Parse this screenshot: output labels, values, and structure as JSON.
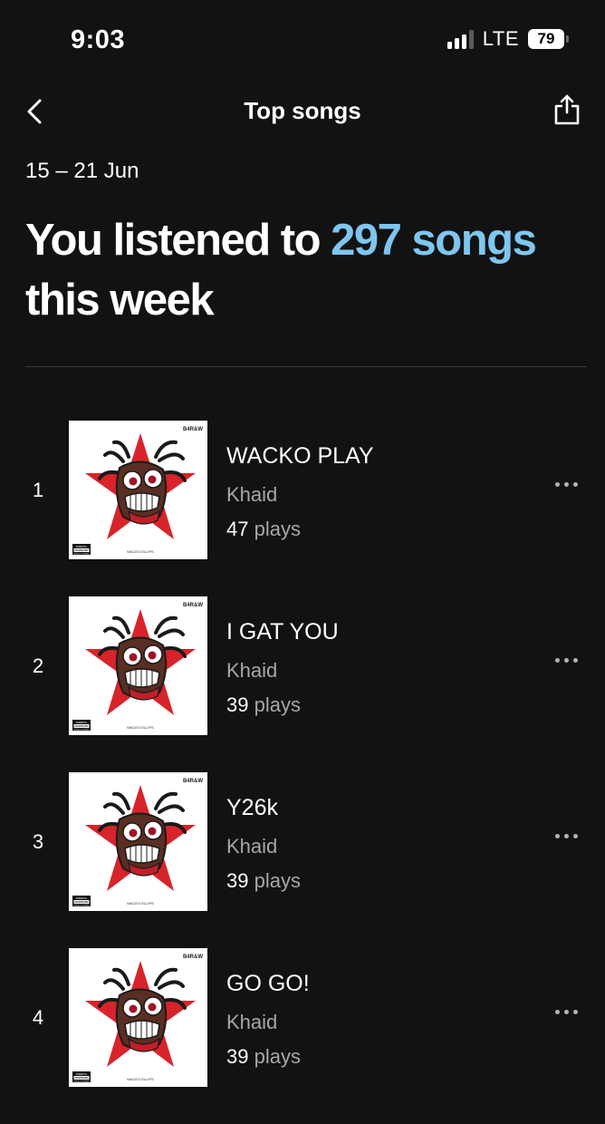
{
  "status_bar": {
    "time": "9:03",
    "network": "LTE",
    "battery": "79"
  },
  "nav": {
    "title": "Top songs",
    "back_icon": "chevron-left-icon",
    "share_icon": "share-icon"
  },
  "summary": {
    "date_range": "15 – 21 Jun",
    "headline_prefix": "You listened to ",
    "headline_count": "297 songs",
    "headline_suffix": "this week",
    "accent_color": "#7ec6ef"
  },
  "songs": [
    {
      "rank": "1",
      "title": "WACKO PLAY",
      "artist": "Khaid",
      "plays_count": "47",
      "plays_label": " plays"
    },
    {
      "rank": "2",
      "title": "I GAT YOU",
      "artist": "Khaid",
      "plays_count": "39",
      "plays_label": " plays"
    },
    {
      "rank": "3",
      "title": "Y26k",
      "artist": "Khaid",
      "plays_count": "39",
      "plays_label": " plays"
    },
    {
      "rank": "4",
      "title": "GO GO!",
      "artist": "Khaid",
      "plays_count": "39",
      "plays_label": " plays"
    }
  ],
  "cover_art": {
    "label": "B4R&W",
    "advisory_line1": "PARENTAL",
    "advisory_line2": "ADVISORY",
    "advisory_line3": "EXPLICIT CONTENT",
    "caption": "WACKO ELLIPS"
  }
}
